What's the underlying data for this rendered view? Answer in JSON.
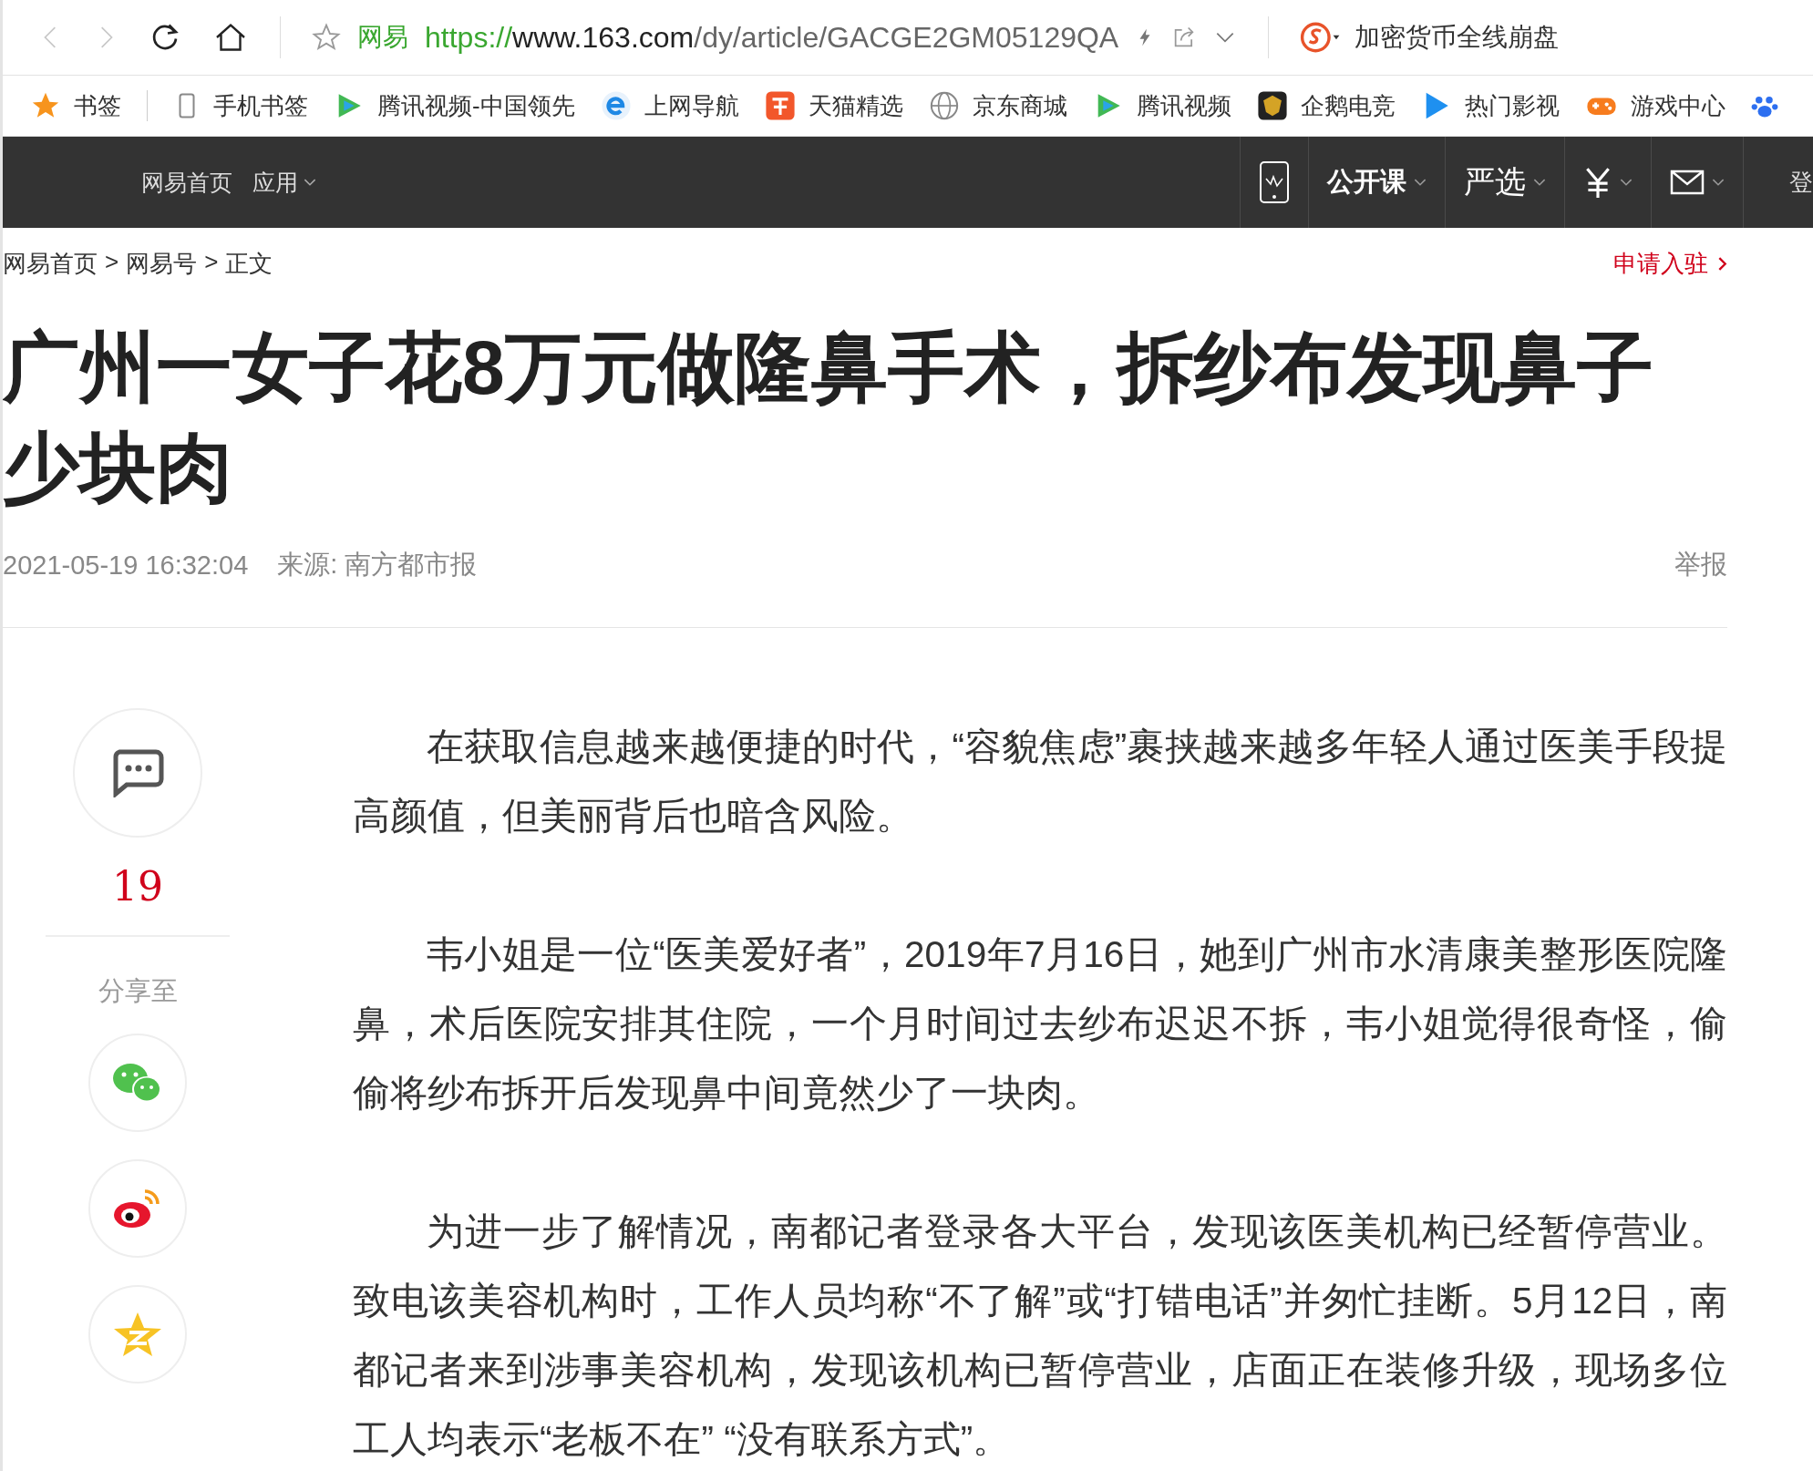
{
  "browser": {
    "site_label": "网易",
    "url_scheme": "https://",
    "url_host": "www.163.com",
    "url_path": "/dy/article/GACGE2GM05129QA",
    "search_text": "加密货币全线崩盘"
  },
  "bookmarks": [
    {
      "kind": "star",
      "label": "书签"
    },
    {
      "kind": "phone",
      "label": "手机书签"
    },
    {
      "kind": "video",
      "label": "腾讯视频-中国领先"
    },
    {
      "kind": "ie",
      "label": "上网导航"
    },
    {
      "kind": "taobao",
      "label": "天猫精选"
    },
    {
      "kind": "globe",
      "label": "京东商城"
    },
    {
      "kind": "video",
      "label": "腾讯视频"
    },
    {
      "kind": "esports",
      "label": "企鹅电竞"
    },
    {
      "kind": "play",
      "label": "热门影视"
    },
    {
      "kind": "game",
      "label": "游戏中心"
    },
    {
      "kind": "paw"
    }
  ],
  "site_nav": {
    "left": [
      {
        "label": "网易首页",
        "dropdown": false
      },
      {
        "label": "应用",
        "dropdown": true
      }
    ],
    "right": [
      {
        "kind": "app"
      },
      {
        "kind": "text",
        "label": "公开课"
      },
      {
        "kind": "script",
        "label": "严选"
      },
      {
        "kind": "yen"
      },
      {
        "kind": "mail"
      }
    ],
    "login": "登"
  },
  "breadcrumb": [
    {
      "label": "网易首页"
    },
    {
      "label": "网易号"
    },
    {
      "label": "正文"
    }
  ],
  "breadcrumb_separator": ">",
  "apply_link": "申请入驻",
  "article": {
    "title": "广州一女子花8万元做隆鼻手术，拆纱布发现鼻子少块肉",
    "date": "2021-05-19 16:32:04",
    "source": "来源: 南方都市报",
    "report": "举报",
    "paragraphs": [
      "在获取信息越来越便捷的时代，“容貌焦虑”裹挟越来越多年轻人通过医美手段提高颜值，但美丽背后也暗含风险。",
      "韦小姐是一位“医美爱好者”，2019年7月16日，她到广州市水清康美整形医院隆鼻，术后医院安排其住院，一个月时间过去纱布迟迟不拆，韦小姐觉得很奇怪，偷偷将纱布拆开后发现鼻中间竟然少了一块肉。",
      "为进一步了解情况，南都记者登录各大平台，发现该医美机构已经暂停营业。致电该美容机构时，工作人员均称“不了解”或“打错电话”并匆忙挂断。5月12日，南都记者来到涉事美容机构，发现该机构已暂停营业，店面正在装修升级，现场多位工人均表示“老板不在” “没有联系方式”。"
    ]
  },
  "side_rail": {
    "comment_count": "19",
    "share_label": "分享至",
    "share_targets": [
      {
        "kind": "wechat"
      },
      {
        "kind": "weibo"
      },
      {
        "kind": "qzone"
      }
    ]
  }
}
